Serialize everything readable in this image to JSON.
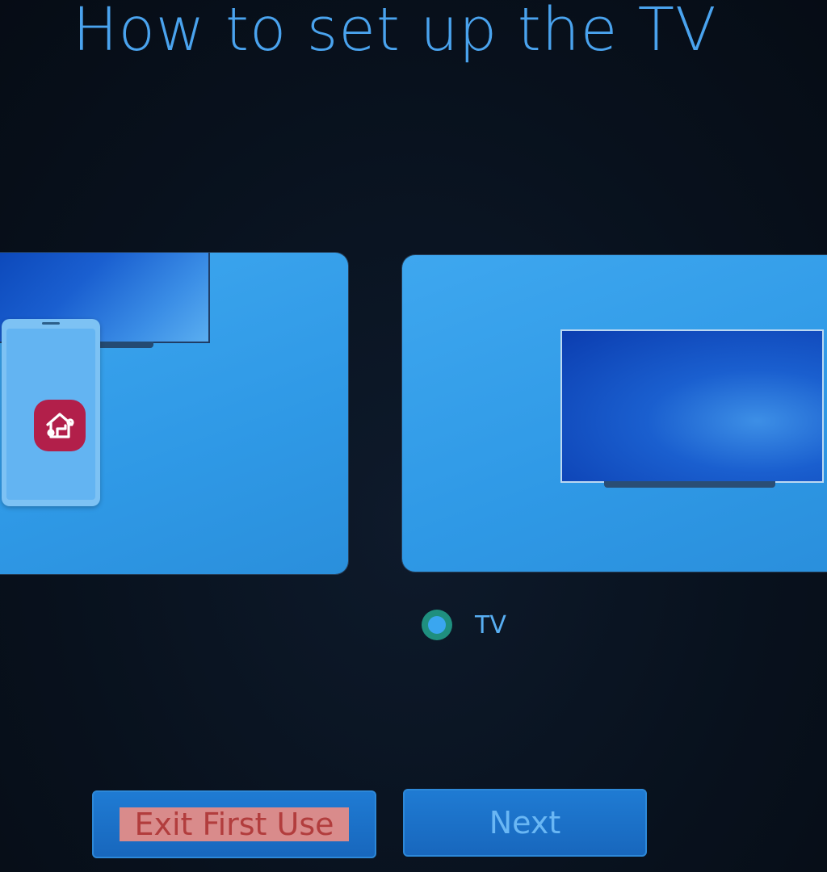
{
  "page": {
    "title": "How to set up the TV"
  },
  "options": [
    {
      "label": "TV",
      "selected": true
    }
  ],
  "buttons": {
    "exit_label": "Exit First Use",
    "next_label": "Next"
  },
  "colors": {
    "accent": "#4aa3ee",
    "card": "#3ea7ef",
    "background": "#08111d",
    "app_icon": "#b21f4a"
  },
  "icons": {
    "app": "smart-home-icon"
  }
}
